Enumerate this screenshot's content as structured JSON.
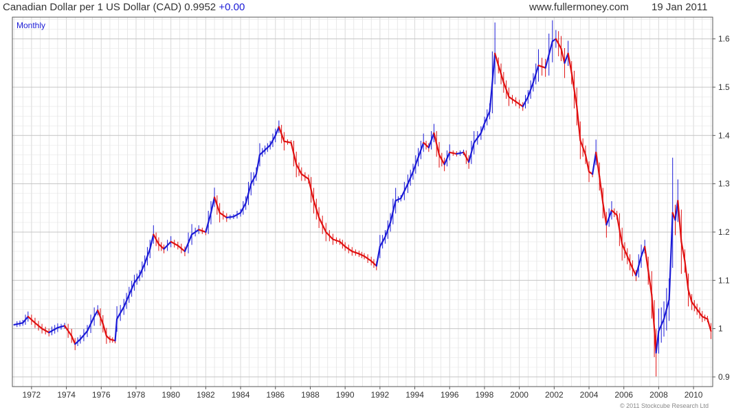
{
  "header": {
    "title": "Canadian Dollar per 1 US Dollar (CAD) 0.9952",
    "change": "+0.00",
    "site": "www.fullermoney.com",
    "date": "19 Jan 2011"
  },
  "footer": {
    "copyright": "© 2011 Stockcube Research Ltd"
  },
  "colors": {
    "up": "#1a1ad6",
    "down": "#e01010",
    "grid": "#d8d8d8",
    "frame": "#555555",
    "period_label": "#1a1ad6"
  },
  "chart_data": {
    "type": "line",
    "period_label": "Monthly",
    "title": "Canadian Dollar per 1 US Dollar (CAD) 0.9952",
    "xlabel": "",
    "ylabel": "",
    "xlim": [
      1970.9,
      2011.1
    ],
    "ylim": [
      0.88,
      1.645
    ],
    "x_ticks": [
      "1972",
      "1974",
      "1976",
      "1978",
      "1980",
      "1982",
      "1984",
      "1986",
      "1988",
      "1990",
      "1992",
      "1994",
      "1996",
      "1998",
      "2000",
      "2002",
      "2004",
      "2006",
      "2008",
      "2010"
    ],
    "y_ticks": [
      "1.6",
      "1.5",
      "1.4",
      "1.3",
      "1.2",
      "1.1",
      "1",
      "0.9"
    ],
    "y_tick_values": [
      1.6,
      1.5,
      1.4,
      1.3,
      1.2,
      1.1,
      1.0,
      0.9
    ],
    "grid": true,
    "series": [
      {
        "color_rule": "blue when rising, red when falling",
        "points": [
          [
            1971.0,
            1.008
          ],
          [
            1971.5,
            1.012
          ],
          [
            1971.8,
            1.025
          ],
          [
            1972.2,
            1.012
          ],
          [
            1972.6,
            1.0
          ],
          [
            1973.0,
            0.992
          ],
          [
            1973.5,
            1.002
          ],
          [
            1973.9,
            1.006
          ],
          [
            1974.3,
            0.985
          ],
          [
            1974.5,
            0.968
          ],
          [
            1974.8,
            0.978
          ],
          [
            1975.2,
            0.995
          ],
          [
            1975.6,
            1.025
          ],
          [
            1975.8,
            1.038
          ],
          [
            1976.1,
            1.01
          ],
          [
            1976.3,
            0.985
          ],
          [
            1976.5,
            0.978
          ],
          [
            1976.8,
            0.975
          ],
          [
            1976.9,
            1.02
          ],
          [
            1977.3,
            1.045
          ],
          [
            1977.6,
            1.07
          ],
          [
            1977.9,
            1.095
          ],
          [
            1978.2,
            1.11
          ],
          [
            1978.5,
            1.135
          ],
          [
            1978.8,
            1.165
          ],
          [
            1979.0,
            1.195
          ],
          [
            1979.3,
            1.175
          ],
          [
            1979.6,
            1.165
          ],
          [
            1980.0,
            1.18
          ],
          [
            1980.4,
            1.172
          ],
          [
            1980.8,
            1.16
          ],
          [
            1981.2,
            1.195
          ],
          [
            1981.6,
            1.205
          ],
          [
            1982.0,
            1.2
          ],
          [
            1982.3,
            1.24
          ],
          [
            1982.5,
            1.272
          ],
          [
            1982.8,
            1.24
          ],
          [
            1983.2,
            1.23
          ],
          [
            1983.6,
            1.232
          ],
          [
            1984.0,
            1.24
          ],
          [
            1984.3,
            1.26
          ],
          [
            1984.6,
            1.3
          ],
          [
            1984.9,
            1.32
          ],
          [
            1985.1,
            1.36
          ],
          [
            1985.4,
            1.37
          ],
          [
            1985.7,
            1.38
          ],
          [
            1986.0,
            1.4
          ],
          [
            1986.2,
            1.418
          ],
          [
            1986.5,
            1.388
          ],
          [
            1986.9,
            1.385
          ],
          [
            1987.2,
            1.34
          ],
          [
            1987.5,
            1.32
          ],
          [
            1987.9,
            1.31
          ],
          [
            1988.2,
            1.265
          ],
          [
            1988.5,
            1.23
          ],
          [
            1988.9,
            1.2
          ],
          [
            1989.3,
            1.185
          ],
          [
            1989.7,
            1.18
          ],
          [
            1990.0,
            1.17
          ],
          [
            1990.4,
            1.16
          ],
          [
            1990.8,
            1.155
          ],
          [
            1991.1,
            1.15
          ],
          [
            1991.5,
            1.14
          ],
          [
            1991.8,
            1.13
          ],
          [
            1992.0,
            1.17
          ],
          [
            1992.3,
            1.19
          ],
          [
            1992.6,
            1.22
          ],
          [
            1992.9,
            1.265
          ],
          [
            1993.2,
            1.27
          ],
          [
            1993.6,
            1.3
          ],
          [
            1993.9,
            1.325
          ],
          [
            1994.2,
            1.355
          ],
          [
            1994.5,
            1.385
          ],
          [
            1994.8,
            1.375
          ],
          [
            1995.1,
            1.405
          ],
          [
            1995.4,
            1.36
          ],
          [
            1995.7,
            1.34
          ],
          [
            1996.0,
            1.365
          ],
          [
            1996.4,
            1.362
          ],
          [
            1996.8,
            1.365
          ],
          [
            1997.1,
            1.345
          ],
          [
            1997.4,
            1.385
          ],
          [
            1997.8,
            1.405
          ],
          [
            1998.0,
            1.425
          ],
          [
            1998.3,
            1.45
          ],
          [
            1998.6,
            1.57
          ],
          [
            1998.8,
            1.545
          ],
          [
            1999.1,
            1.51
          ],
          [
            1999.4,
            1.48
          ],
          [
            1999.8,
            1.47
          ],
          [
            2000.2,
            1.46
          ],
          [
            2000.5,
            1.48
          ],
          [
            2000.8,
            1.51
          ],
          [
            2001.1,
            1.545
          ],
          [
            2001.5,
            1.54
          ],
          [
            2001.9,
            1.595
          ],
          [
            2002.1,
            1.6
          ],
          [
            2002.4,
            1.58
          ],
          [
            2002.6,
            1.55
          ],
          [
            2002.8,
            1.57
          ],
          [
            2003.0,
            1.53
          ],
          [
            2003.3,
            1.46
          ],
          [
            2003.5,
            1.39
          ],
          [
            2003.8,
            1.36
          ],
          [
            2004.0,
            1.325
          ],
          [
            2004.2,
            1.32
          ],
          [
            2004.4,
            1.365
          ],
          [
            2004.6,
            1.315
          ],
          [
            2004.8,
            1.26
          ],
          [
            2005.0,
            1.215
          ],
          [
            2005.3,
            1.245
          ],
          [
            2005.6,
            1.235
          ],
          [
            2005.9,
            1.175
          ],
          [
            2006.2,
            1.15
          ],
          [
            2006.5,
            1.125
          ],
          [
            2006.7,
            1.11
          ],
          [
            2007.0,
            1.15
          ],
          [
            2007.2,
            1.17
          ],
          [
            2007.4,
            1.12
          ],
          [
            2007.6,
            1.07
          ],
          [
            2007.75,
            1.0
          ],
          [
            2007.85,
            0.95
          ],
          [
            2008.0,
            0.995
          ],
          [
            2008.3,
            1.02
          ],
          [
            2008.6,
            1.06
          ],
          [
            2008.8,
            1.24
          ],
          [
            2008.95,
            1.225
          ],
          [
            2009.1,
            1.265
          ],
          [
            2009.3,
            1.18
          ],
          [
            2009.5,
            1.14
          ],
          [
            2009.7,
            1.08
          ],
          [
            2009.9,
            1.055
          ],
          [
            2010.2,
            1.04
          ],
          [
            2010.5,
            1.025
          ],
          [
            2010.8,
            1.02
          ],
          [
            2011.0,
            0.995
          ]
        ]
      }
    ]
  }
}
